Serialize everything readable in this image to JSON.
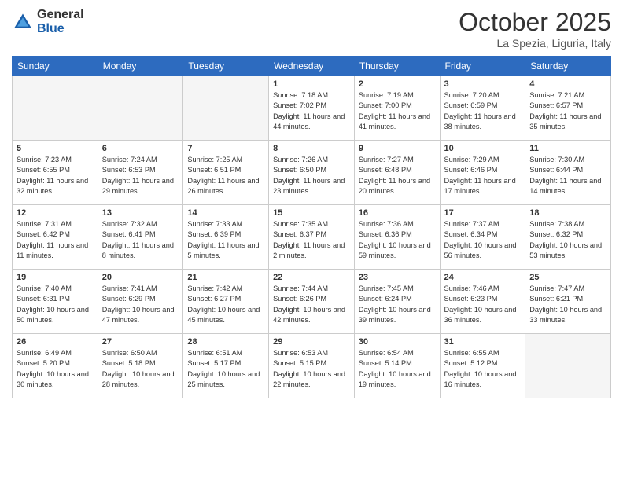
{
  "header": {
    "logo_general": "General",
    "logo_blue": "Blue",
    "month_title": "October 2025",
    "location": "La Spezia, Liguria, Italy"
  },
  "days_of_week": [
    "Sunday",
    "Monday",
    "Tuesday",
    "Wednesday",
    "Thursday",
    "Friday",
    "Saturday"
  ],
  "weeks": [
    [
      {
        "day": "",
        "empty": true
      },
      {
        "day": "",
        "empty": true
      },
      {
        "day": "",
        "empty": true
      },
      {
        "day": "1",
        "sunrise": "7:18 AM",
        "sunset": "7:02 PM",
        "daylight": "11 hours and 44 minutes."
      },
      {
        "day": "2",
        "sunrise": "7:19 AM",
        "sunset": "7:00 PM",
        "daylight": "11 hours and 41 minutes."
      },
      {
        "day": "3",
        "sunrise": "7:20 AM",
        "sunset": "6:59 PM",
        "daylight": "11 hours and 38 minutes."
      },
      {
        "day": "4",
        "sunrise": "7:21 AM",
        "sunset": "6:57 PM",
        "daylight": "11 hours and 35 minutes."
      }
    ],
    [
      {
        "day": "5",
        "sunrise": "7:23 AM",
        "sunset": "6:55 PM",
        "daylight": "11 hours and 32 minutes."
      },
      {
        "day": "6",
        "sunrise": "7:24 AM",
        "sunset": "6:53 PM",
        "daylight": "11 hours and 29 minutes."
      },
      {
        "day": "7",
        "sunrise": "7:25 AM",
        "sunset": "6:51 PM",
        "daylight": "11 hours and 26 minutes."
      },
      {
        "day": "8",
        "sunrise": "7:26 AM",
        "sunset": "6:50 PM",
        "daylight": "11 hours and 23 minutes."
      },
      {
        "day": "9",
        "sunrise": "7:27 AM",
        "sunset": "6:48 PM",
        "daylight": "11 hours and 20 minutes."
      },
      {
        "day": "10",
        "sunrise": "7:29 AM",
        "sunset": "6:46 PM",
        "daylight": "11 hours and 17 minutes."
      },
      {
        "day": "11",
        "sunrise": "7:30 AM",
        "sunset": "6:44 PM",
        "daylight": "11 hours and 14 minutes."
      }
    ],
    [
      {
        "day": "12",
        "sunrise": "7:31 AM",
        "sunset": "6:42 PM",
        "daylight": "11 hours and 11 minutes."
      },
      {
        "day": "13",
        "sunrise": "7:32 AM",
        "sunset": "6:41 PM",
        "daylight": "11 hours and 8 minutes."
      },
      {
        "day": "14",
        "sunrise": "7:33 AM",
        "sunset": "6:39 PM",
        "daylight": "11 hours and 5 minutes."
      },
      {
        "day": "15",
        "sunrise": "7:35 AM",
        "sunset": "6:37 PM",
        "daylight": "11 hours and 2 minutes."
      },
      {
        "day": "16",
        "sunrise": "7:36 AM",
        "sunset": "6:36 PM",
        "daylight": "10 hours and 59 minutes."
      },
      {
        "day": "17",
        "sunrise": "7:37 AM",
        "sunset": "6:34 PM",
        "daylight": "10 hours and 56 minutes."
      },
      {
        "day": "18",
        "sunrise": "7:38 AM",
        "sunset": "6:32 PM",
        "daylight": "10 hours and 53 minutes."
      }
    ],
    [
      {
        "day": "19",
        "sunrise": "7:40 AM",
        "sunset": "6:31 PM",
        "daylight": "10 hours and 50 minutes."
      },
      {
        "day": "20",
        "sunrise": "7:41 AM",
        "sunset": "6:29 PM",
        "daylight": "10 hours and 47 minutes."
      },
      {
        "day": "21",
        "sunrise": "7:42 AM",
        "sunset": "6:27 PM",
        "daylight": "10 hours and 45 minutes."
      },
      {
        "day": "22",
        "sunrise": "7:44 AM",
        "sunset": "6:26 PM",
        "daylight": "10 hours and 42 minutes."
      },
      {
        "day": "23",
        "sunrise": "7:45 AM",
        "sunset": "6:24 PM",
        "daylight": "10 hours and 39 minutes."
      },
      {
        "day": "24",
        "sunrise": "7:46 AM",
        "sunset": "6:23 PM",
        "daylight": "10 hours and 36 minutes."
      },
      {
        "day": "25",
        "sunrise": "7:47 AM",
        "sunset": "6:21 PM",
        "daylight": "10 hours and 33 minutes."
      }
    ],
    [
      {
        "day": "26",
        "sunrise": "6:49 AM",
        "sunset": "5:20 PM",
        "daylight": "10 hours and 30 minutes."
      },
      {
        "day": "27",
        "sunrise": "6:50 AM",
        "sunset": "5:18 PM",
        "daylight": "10 hours and 28 minutes."
      },
      {
        "day": "28",
        "sunrise": "6:51 AM",
        "sunset": "5:17 PM",
        "daylight": "10 hours and 25 minutes."
      },
      {
        "day": "29",
        "sunrise": "6:53 AM",
        "sunset": "5:15 PM",
        "daylight": "10 hours and 22 minutes."
      },
      {
        "day": "30",
        "sunrise": "6:54 AM",
        "sunset": "5:14 PM",
        "daylight": "10 hours and 19 minutes."
      },
      {
        "day": "31",
        "sunrise": "6:55 AM",
        "sunset": "5:12 PM",
        "daylight": "10 hours and 16 minutes."
      },
      {
        "day": "",
        "empty": true
      }
    ]
  ],
  "labels": {
    "sunrise": "Sunrise:",
    "sunset": "Sunset:",
    "daylight": "Daylight:"
  }
}
